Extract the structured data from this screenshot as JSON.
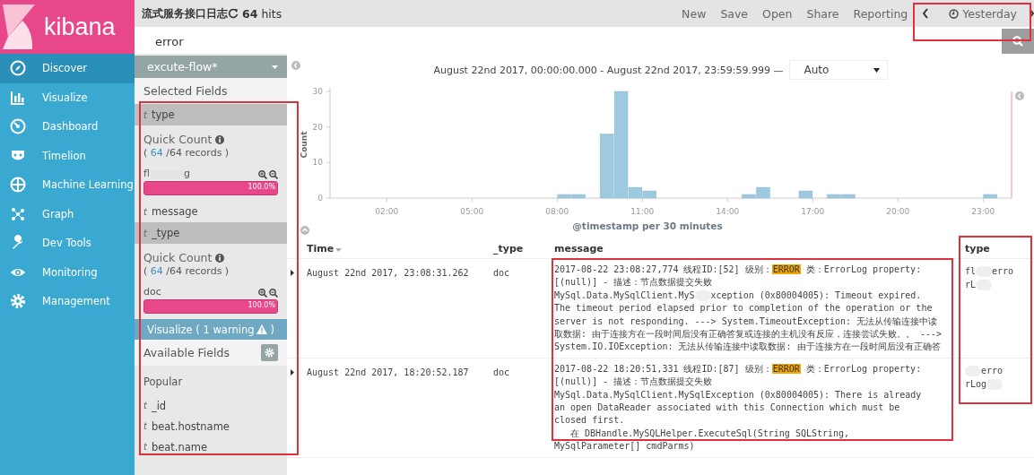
{
  "logo": {
    "text": "kibana"
  },
  "nav": [
    {
      "label": "Discover",
      "selected": true
    },
    {
      "label": "Visualize",
      "selected": false
    },
    {
      "label": "Dashboard",
      "selected": false
    },
    {
      "label": "Timelion",
      "selected": false
    },
    {
      "label": "Machine Learning",
      "selected": false
    },
    {
      "label": "Graph",
      "selected": false
    },
    {
      "label": "Dev Tools",
      "selected": false
    },
    {
      "label": "Monitoring",
      "selected": false
    },
    {
      "label": "Management",
      "selected": false
    }
  ],
  "topbar": {
    "title": "流式服务接口日志",
    "hits_count": "64",
    "hits_label": "hits",
    "menu": [
      "New",
      "Save",
      "Open",
      "Share",
      "Reporting"
    ],
    "time_range": "Yesterday"
  },
  "search": {
    "value": "error"
  },
  "fields_panel": {
    "index_pattern": "excute-flow*",
    "selected_heading": "Selected Fields",
    "selected_fields": [
      {
        "type_mark": "t",
        "name": "type",
        "expanded": true,
        "quick_count": "Quick Count",
        "records_prefix": "(",
        "records_count": "64",
        "records_suffix": "/64 records )",
        "values": [
          {
            "segments": [
              {
                "kind": "text",
                "text": "fl"
              },
              {
                "kind": "redacted"
              },
              {
                "kind": "text",
                "text": "g"
              }
            ],
            "level": 1.0,
            "percent": "100.0%"
          }
        ]
      },
      {
        "type_mark": "t",
        "name": "message",
        "expanded": false
      },
      {
        "type_mark": "t",
        "name": "_type",
        "expanded": true,
        "quick_count": "Quick Count",
        "records_prefix": "(",
        "records_count": "64",
        "records_suffix": "/64 records )",
        "values": [
          {
            "segments": [
              {
                "kind": "text",
                "text": "doc"
              }
            ],
            "level": 1.0,
            "percent": "100.0%"
          }
        ]
      }
    ],
    "visualize_button": {
      "label": "Visualize ( 1 warning",
      "suffix": ")"
    },
    "available_heading": "Available Fields",
    "popular_heading": "Popular",
    "available_fields": [
      {
        "type_mark": "t",
        "name": "_id"
      },
      {
        "type_mark": "t",
        "name": "beat.hostname"
      },
      {
        "type_mark": "t",
        "name": "beat.name"
      }
    ]
  },
  "histogram": {
    "range_text": "August 22nd 2017, 00:00:00.000 - August 22nd 2017, 23:59:59.999 —",
    "interval": "Auto",
    "chart_data": {
      "type": "bar",
      "xlabel": "@timestamp per 30 minutes",
      "ylabel": "Count",
      "x": [
        8.25,
        8.75,
        9.75,
        10.25,
        10.75,
        11.25,
        14.75,
        15.25,
        16.75,
        17.75,
        18.25,
        23.25
      ],
      "xlim": [
        0,
        24
      ],
      "series": [
        {
          "color": "#9ecae1",
          "values": [
            1,
            1,
            18,
            30,
            3,
            2,
            1,
            3,
            2,
            1,
            1,
            1
          ]
        }
      ],
      "ylim": [
        0,
        30
      ],
      "yticks": [
        0,
        10,
        20,
        30
      ],
      "xticks": [
        {
          "value": 2,
          "label": "02:00"
        },
        {
          "value": 5,
          "label": "05:00"
        },
        {
          "value": 8,
          "label": "08:00"
        },
        {
          "value": 11,
          "label": "11:00"
        },
        {
          "value": 14,
          "label": "14:00"
        },
        {
          "value": 17,
          "label": "17:00"
        },
        {
          "value": 20,
          "label": "20:00"
        },
        {
          "value": 23,
          "label": "23:00"
        }
      ]
    }
  },
  "table": {
    "columns": [
      {
        "label": "Time",
        "sorted": true
      },
      {
        "label": "_type",
        "sorted": false
      },
      {
        "label": "message",
        "sorted": false
      },
      {
        "label": "type",
        "sorted": false
      }
    ],
    "rows": [
      {
        "time": "August 22nd 2017, 23:08:31.262",
        "_type": "doc",
        "message": [
          [
            {
              "kind": "text",
              "text": "2017-08-22 23:08:27,774 线程ID:[52] 级别："
            },
            {
              "kind": "highlight",
              "text": "ERROR"
            },
            {
              "kind": "text",
              "text": " 类：ErrorLog property:"
            }
          ],
          [
            {
              "kind": "text",
              "text": "[(null)] - 描述：节点数据提交失败"
            }
          ],
          [
            {
              "kind": "text",
              "text": "MySql.Data.MySqlClient.MyS"
            },
            {
              "kind": "redacted"
            },
            {
              "kind": "text",
              "text": "xception (0x80004005): Timeout expired."
            }
          ],
          [
            {
              "kind": "text",
              "text": "The timeout period elapsed prior to completion of the operation or the"
            }
          ],
          [
            {
              "kind": "text",
              "text": "server is not responding. ---> System.TimeoutException: 无法从传输连接中读"
            }
          ],
          [
            {
              "kind": "text",
              "text": "取数据: 由于连接方在一段时间后没有正确答复或连接的主机没有反应，连接尝试失败。。 --->"
            }
          ],
          [
            {
              "kind": "text",
              "text": "System.IO.IOException: 无法从传输连接中读取数据: 由于连接方在一段时间后没有正确答"
            }
          ]
        ],
        "type": [
          [
            {
              "kind": "text",
              "text": "fl"
            },
            {
              "kind": "redacted"
            },
            {
              "kind": "text",
              "text": "erro"
            }
          ],
          [
            {
              "kind": "text",
              "text": "rL"
            },
            {
              "kind": "redacted"
            }
          ]
        ]
      },
      {
        "time": "August 22nd 2017, 18:20:52.187",
        "_type": "doc",
        "message": [
          [
            {
              "kind": "text",
              "text": "2017-08-22 18:20:51,331 线程ID:[87] 级别："
            },
            {
              "kind": "highlight",
              "text": "ERROR"
            },
            {
              "kind": "text",
              "text": " 类：ErrorLog property:"
            }
          ],
          [
            {
              "kind": "text",
              "text": "[(null)] - 描述：节点数据提交失败"
            }
          ],
          [
            {
              "kind": "text",
              "text": "MySql.Data.MySqlClient.MySqlException (0x80004005): There is already"
            }
          ],
          [
            {
              "kind": "text",
              "text": "an open DataReader associated with this Connection which must be"
            }
          ],
          [
            {
              "kind": "text",
              "text": "closed first."
            }
          ],
          [
            {
              "kind": "text",
              "text": "   在 DBHandle.MySQLHelper.ExecuteSql(String SQLString,"
            }
          ],
          [
            {
              "kind": "text",
              "text": "MySqlParameter[] cmdParms)"
            }
          ]
        ],
        "type": [
          [
            {
              "kind": "redacted"
            },
            {
              "kind": "text",
              "text": "erro"
            }
          ],
          [
            {
              "kind": "text",
              "text": "rLog"
            },
            {
              "kind": "redacted"
            }
          ]
        ]
      }
    ]
  }
}
